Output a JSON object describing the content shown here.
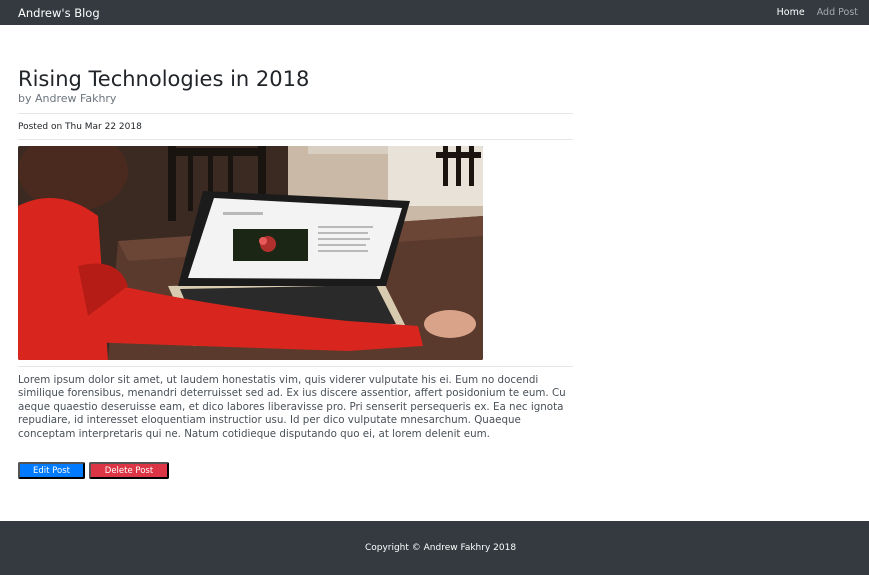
{
  "navbar": {
    "brand": "Andrew's Blog",
    "links": [
      {
        "label": "Home",
        "active": true
      },
      {
        "label": "Add Post",
        "active": false
      }
    ]
  },
  "post": {
    "title": "Rising Technologies in 2018",
    "author": "by Andrew Fakhry",
    "date": "Posted on Thu Mar 22 2018",
    "image": "laptop-photo",
    "body": "Lorem ipsum dolor sit amet, ut laudem honestatis vim, quis viderer vulputate his ei. Eum no docendi similique forensibus, menandri deterruisset sed ad. Ex ius discere assentior, affert posidonium te eum. Cu aeque quaestio deseruisse eam, et dico labores liberavisse pro. Pri senserit persequeris ex. Ea nec ignota repudiare, id interesset eloquentiam instructior usu. Id per dico vulputate mnesarchum. Quaeque conceptam interpretaris qui ne. Natum cotidieque disputando quo ei, at lorem delenit eum."
  },
  "actions": {
    "edit_label": "Edit Post",
    "delete_label": "Delete Post"
  },
  "footer": {
    "copyright": "Copyright © Andrew Fakhry 2018"
  },
  "colors": {
    "navbar_bg": "#343a40",
    "primary": "#007bff",
    "danger": "#dc3545"
  }
}
